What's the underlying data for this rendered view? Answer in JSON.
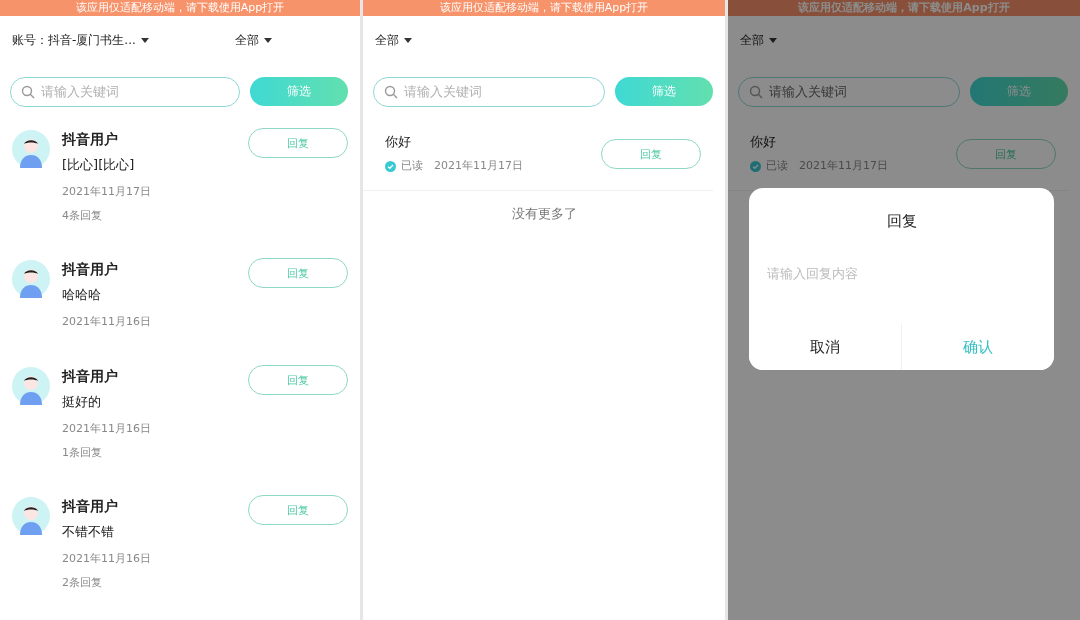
{
  "panels": [
    {
      "banner": "该应用仅适配移动端，请下载使用App打开",
      "account": "账号：抖音-厦门书生...",
      "filter": "全部",
      "search": {
        "placeholder": "请输入关键词"
      },
      "filter_button": "筛选",
      "items": [
        {
          "kind": "comment",
          "name": "抖音用户",
          "text": "[比心][比心]",
          "date": "2021年11月17日",
          "reply_count": "4条回复",
          "button": "回复"
        },
        {
          "kind": "comment",
          "name": "抖音用户",
          "text": "哈哈哈",
          "date": "2021年11月16日",
          "button": "回复"
        },
        {
          "kind": "comment",
          "name": "抖音用户",
          "text": "挺好的",
          "date": "2021年11月16日",
          "reply_count": "1条回复",
          "button": "回复"
        },
        {
          "kind": "comment",
          "name": "抖音用户",
          "text": "不错不错",
          "date": "2021年11月16日",
          "reply_count": "2条回复",
          "button": "回复"
        }
      ]
    },
    {
      "banner": "该应用仅适配移动端，请下载使用App打开",
      "filter": "全部",
      "search": {
        "placeholder": "请输入关键词"
      },
      "filter_button": "筛选",
      "items": [
        {
          "kind": "message",
          "text": "你好",
          "read": true,
          "status": "已读",
          "date": "2021年11月17日",
          "button": "回复"
        }
      ],
      "footer": "没有更多了"
    },
    {
      "banner": "该应用仅适配移动端，请下载使用App打开",
      "filter": "全部",
      "search": {
        "placeholder": "请输入关键词"
      },
      "filter_button": "筛选",
      "items": [
        {
          "kind": "message",
          "text": "你好",
          "read": true,
          "status": "已读",
          "date": "2021年11月17日",
          "button": "回复"
        }
      ],
      "dialog": {
        "title": "回复",
        "placeholder": "请输入回复内容",
        "cancel": "取消",
        "confirm": "确认"
      }
    }
  ]
}
